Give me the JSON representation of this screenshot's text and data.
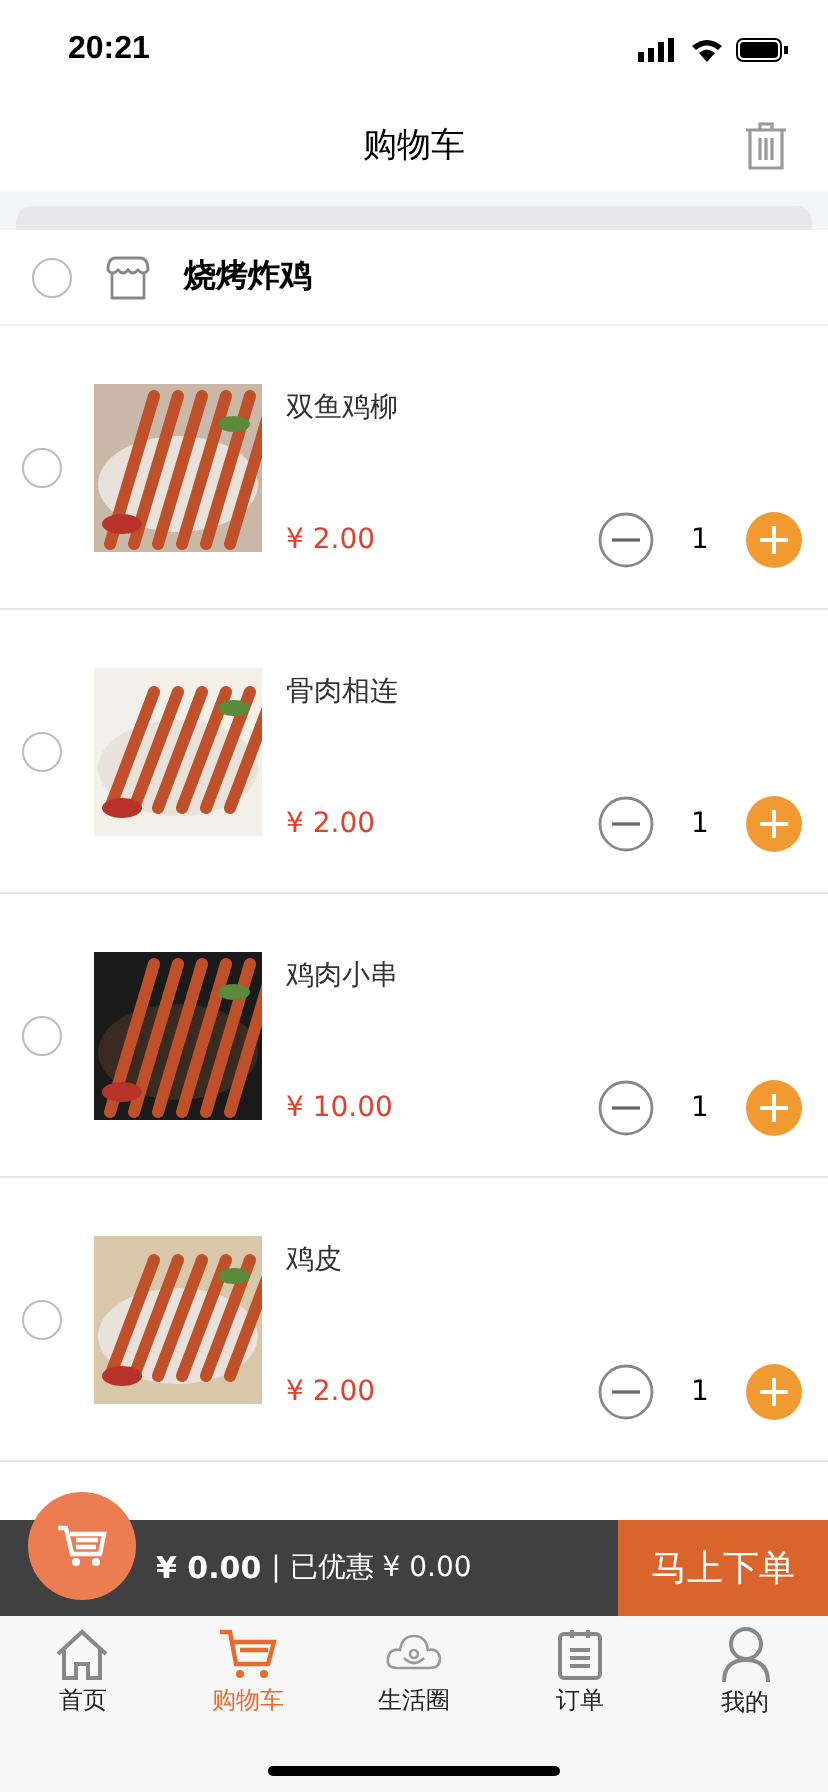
{
  "status_bar": {
    "time": "20:21"
  },
  "header": {
    "title": "购物车"
  },
  "shop": {
    "name": "烧烤炸鸡",
    "checked": false
  },
  "items": [
    {
      "name": "双鱼鸡柳",
      "price": "¥ 2.00",
      "quantity": "1",
      "checked": false
    },
    {
      "name": "骨肉相连",
      "price": "¥ 2.00",
      "quantity": "1",
      "checked": false
    },
    {
      "name": "鸡肉小串",
      "price": "¥ 10.00",
      "quantity": "1",
      "checked": false
    },
    {
      "name": "鸡皮",
      "price": "¥ 2.00",
      "quantity": "1",
      "checked": false
    }
  ],
  "checkout": {
    "total": "¥ 0.00",
    "discount": "| 已优惠 ¥ 0.00",
    "button": "马上下单"
  },
  "tabs": [
    {
      "label": "首页",
      "selected": false
    },
    {
      "label": "购物车",
      "selected": true
    },
    {
      "label": "生活圈",
      "selected": false
    },
    {
      "label": "订单",
      "selected": false
    },
    {
      "label": "我的",
      "selected": false
    }
  ]
}
